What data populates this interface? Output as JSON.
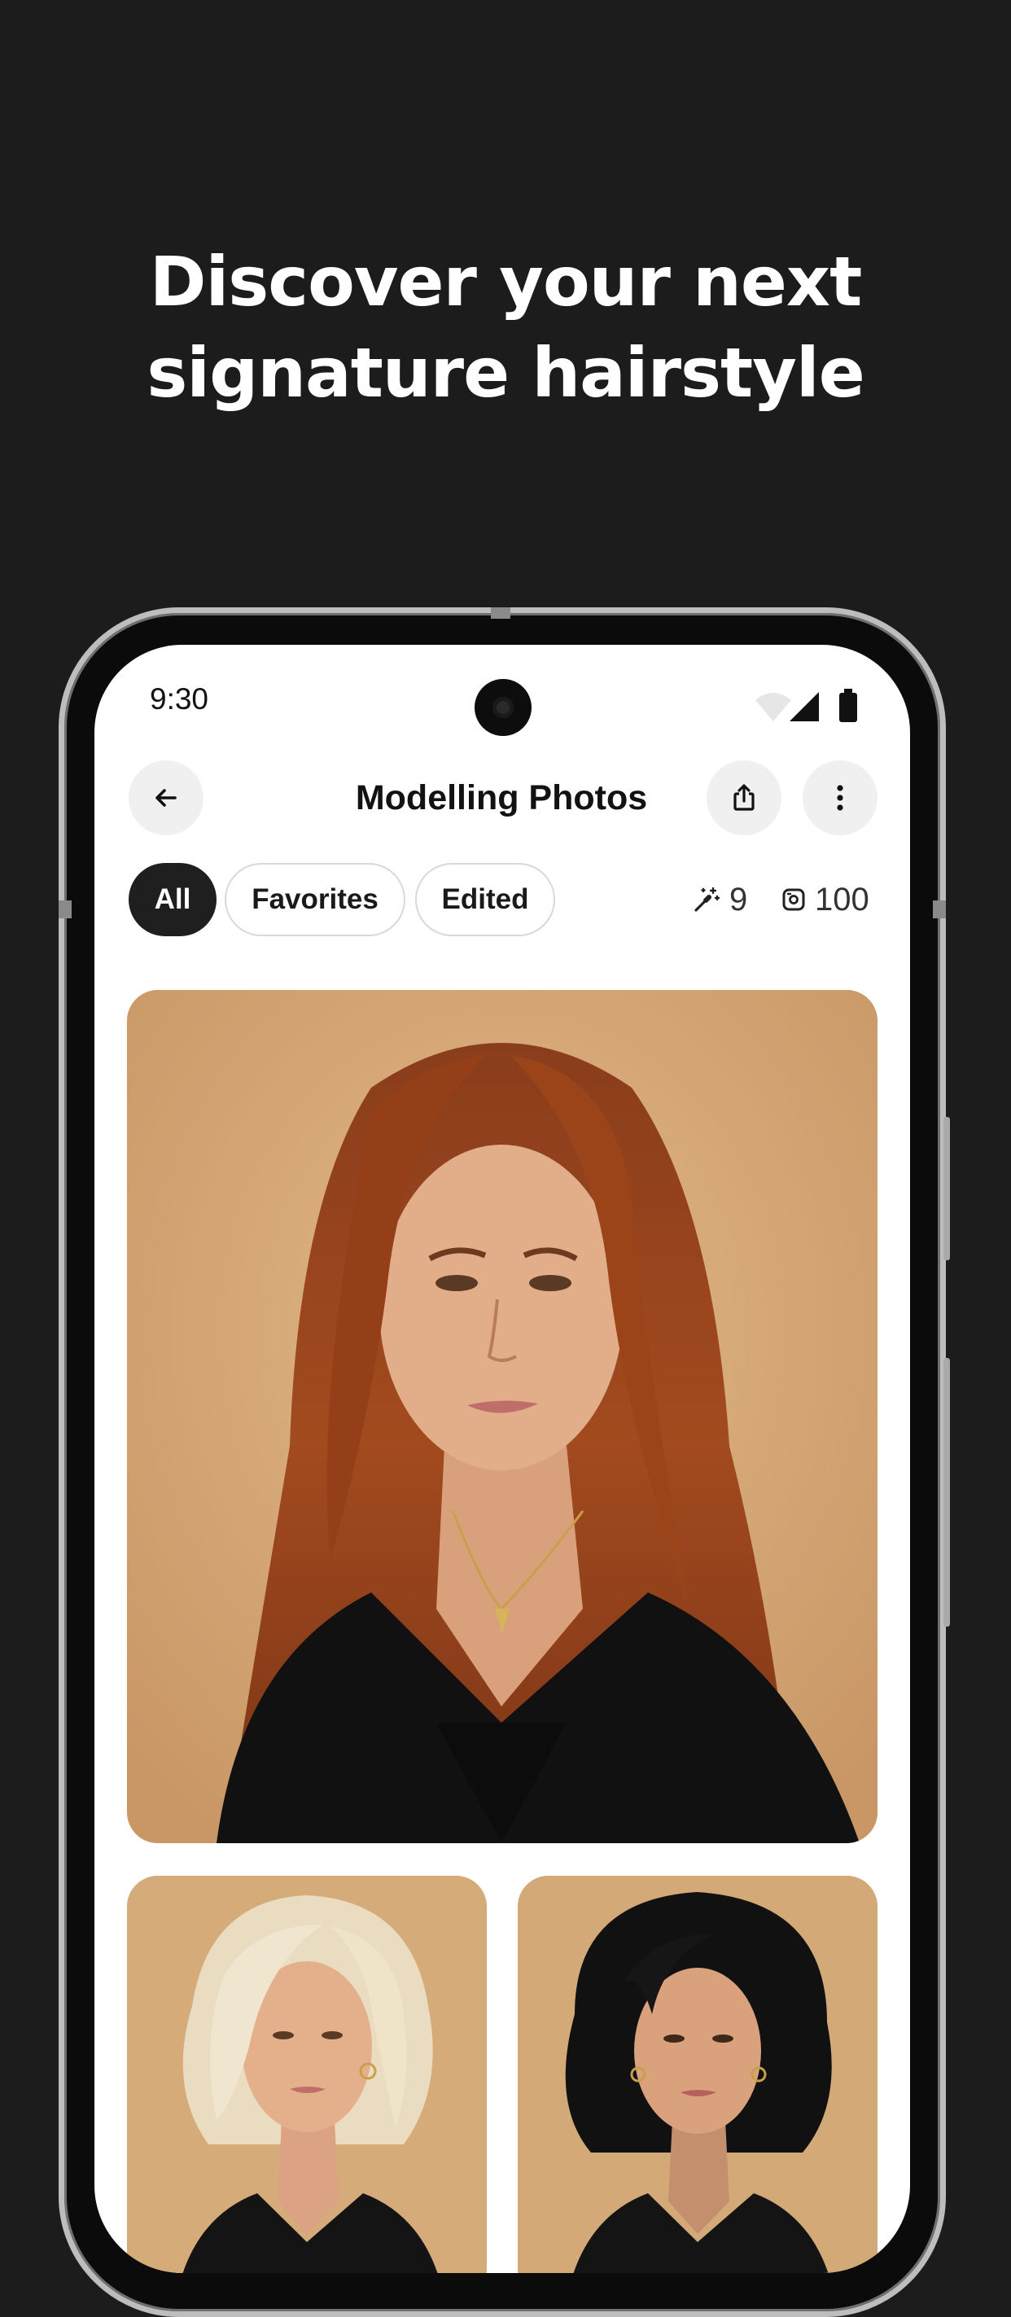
{
  "headline": {
    "line1": "Discover your next",
    "line2": "signature hairstyle"
  },
  "status_bar": {
    "time": "9:30",
    "icons": [
      "wifi-icon",
      "signal-icon",
      "battery-icon"
    ]
  },
  "header": {
    "title": "Modelling Photos",
    "back_icon": "arrow-left-icon",
    "share_icon": "share-icon",
    "more_icon": "more-vertical-icon"
  },
  "filters": {
    "chips": [
      {
        "label": "All",
        "selected": true
      },
      {
        "label": "Favorites",
        "selected": false
      },
      {
        "label": "Edited",
        "selected": false
      }
    ]
  },
  "counters": {
    "edits": {
      "icon": "magic-wand-icon",
      "value": "9"
    },
    "credits": {
      "icon": "credit-icon",
      "value": "100"
    }
  },
  "photos": [
    {
      "hair": "long auburn wavy"
    },
    {
      "hair": "platinum blonde curly bob"
    },
    {
      "hair": "black curly"
    }
  ],
  "colors": {
    "page_background": "#1c1c1c",
    "headline_text": "#ffffff",
    "chip_selected_bg": "#1f1f1f",
    "photo_backdrop": "#d8aa79"
  }
}
